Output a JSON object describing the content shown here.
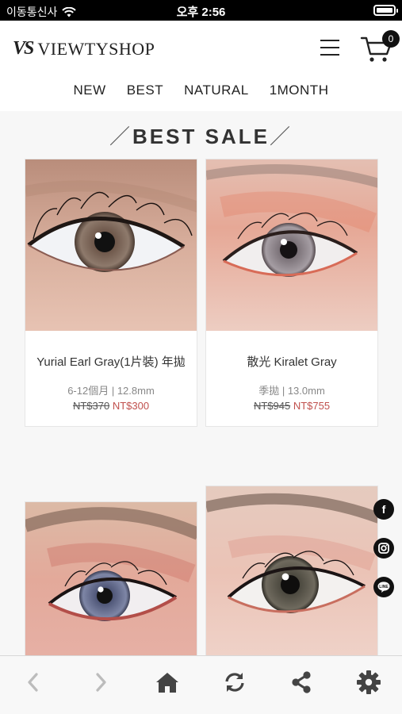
{
  "status_bar": {
    "carrier": "이동통신사",
    "time": "오후 2:56"
  },
  "header": {
    "logo_mark": "VS",
    "logo_text": "VIEWTYSHOP",
    "cart_count": "0",
    "nav": [
      "NEW",
      "BEST",
      "NATURAL",
      "1MONTH"
    ]
  },
  "section": {
    "slash_left": "／",
    "title": "BEST SALE",
    "slash_right": "／"
  },
  "products": [
    {
      "name": "Yurial Earl Gray(1片裝) 年拋",
      "spec": "6-12個月 | 12.8mm",
      "old_price": "NT$370",
      "price": "NT$300"
    },
    {
      "name": "散光 Kiralet Gray",
      "spec": "季拋 | 13.0mm",
      "old_price": "NT$945",
      "price": "NT$755"
    },
    {
      "name": "",
      "spec": "",
      "old_price": "",
      "price": ""
    },
    {
      "name": "",
      "spec": "",
      "old_price": "",
      "price": ""
    }
  ],
  "social": {
    "facebook": "f",
    "instagram": "instagram-icon",
    "line": "LINE"
  },
  "colors": {
    "sale_price": "#c0504d",
    "toolbar_icon": "#444"
  }
}
